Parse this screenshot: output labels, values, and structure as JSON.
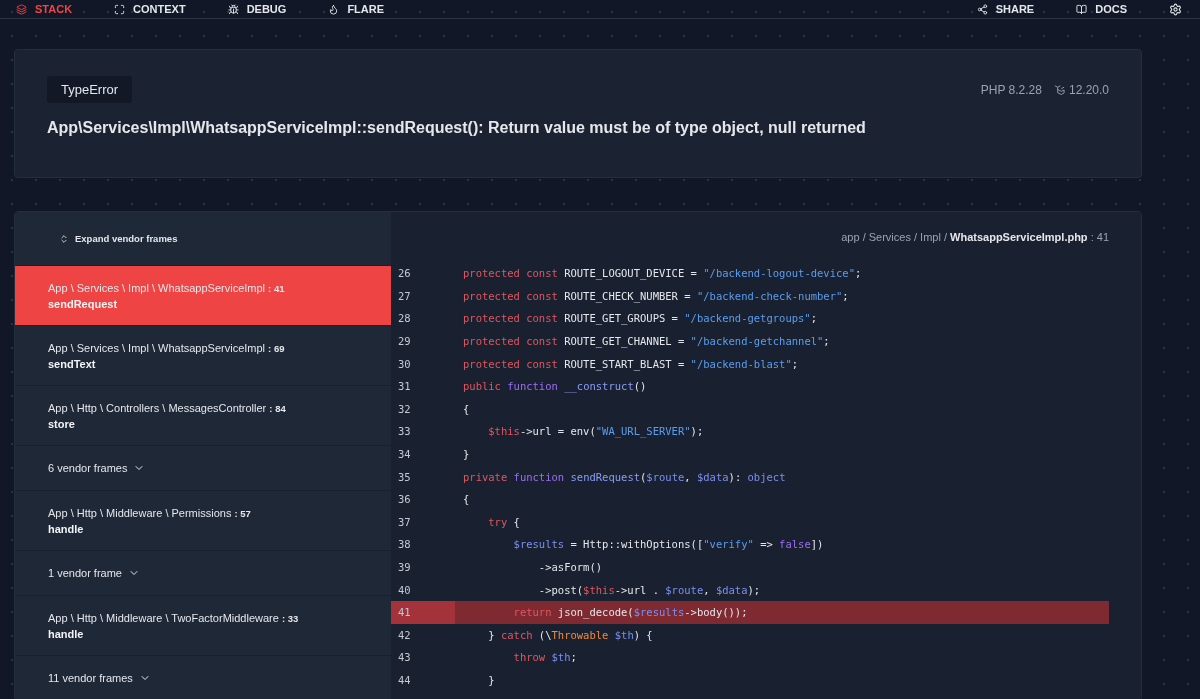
{
  "nav": {
    "left": [
      {
        "label": "STACK",
        "selected": true
      },
      {
        "label": "CONTEXT",
        "selected": false
      },
      {
        "label": "DEBUG",
        "selected": false
      },
      {
        "label": "FLARE",
        "selected": false
      }
    ],
    "right": [
      {
        "label": "SHARE"
      },
      {
        "label": "DOCS"
      }
    ]
  },
  "error": {
    "type": "TypeError",
    "php_version": "PHP 8.2.28",
    "laravel_version": "12.20.0",
    "message": "App\\Services\\Impl\\WhatsappServiceImpl::sendRequest(): Return value must be of type object, null returned"
  },
  "frames_panel": {
    "expand_label": "Expand vendor frames",
    "frames": [
      {
        "kind": "frame",
        "path": "App \\ Services \\ Impl \\ WhatsappServiceImpl",
        "line": ": 41",
        "method": "sendRequest",
        "selected": true
      },
      {
        "kind": "frame",
        "path": "App \\ Services \\ Impl \\ WhatsappServiceImpl",
        "line": ": 69",
        "method": "sendText",
        "selected": false
      },
      {
        "kind": "frame",
        "path": "App \\ Http \\ Controllers \\ MessagesController",
        "line": ": 84",
        "method": "store",
        "selected": false
      },
      {
        "kind": "vendor",
        "label": "6 vendor frames",
        "selected": false
      },
      {
        "kind": "frame",
        "path": "App \\ Http \\ Middleware \\ Permissions",
        "line": ": 57",
        "method": "handle",
        "selected": false
      },
      {
        "kind": "vendor",
        "label": "1 vendor frame",
        "selected": false
      },
      {
        "kind": "frame",
        "path": "App \\ Http \\ Middleware \\ TwoFactorMiddleware",
        "line": ": 33",
        "method": "handle",
        "selected": false
      },
      {
        "kind": "vendor",
        "label": "11 vendor frames",
        "selected": false
      }
    ]
  },
  "code": {
    "file_path": "app / Services / Impl / **WhatsappServiceImpl.php** : 41",
    "lines": [
      {
        "number": "26",
        "selected": false,
        "tokens": [
          {
            "kind": "kw",
            "text": "protected const "
          },
          {
            "kind": "plain",
            "text": "ROUTE_LOGOUT_DEVICE = "
          },
          {
            "kind": "str",
            "text": "\"/backend-logout-device\""
          },
          {
            "kind": "plain",
            "text": ";"
          }
        ]
      },
      {
        "number": "27",
        "selected": false,
        "tokens": [
          {
            "kind": "kw",
            "text": "protected const "
          },
          {
            "kind": "plain",
            "text": "ROUTE_CHECK_NUMBER = "
          },
          {
            "kind": "str",
            "text": "\"/backend-check-number\""
          },
          {
            "kind": "plain",
            "text": ";"
          }
        ]
      },
      {
        "number": "28",
        "selected": false,
        "tokens": [
          {
            "kind": "kw",
            "text": "protected const "
          },
          {
            "kind": "plain",
            "text": "ROUTE_GET_GROUPS = "
          },
          {
            "kind": "str",
            "text": "\"/backend-getgroups\""
          },
          {
            "kind": "plain",
            "text": ";"
          }
        ]
      },
      {
        "number": "29",
        "selected": false,
        "tokens": [
          {
            "kind": "kw",
            "text": "protected const "
          },
          {
            "kind": "plain",
            "text": "ROUTE_GET_CHANNEL = "
          },
          {
            "kind": "str",
            "text": "\"/backend-getchannel\""
          },
          {
            "kind": "plain",
            "text": ";"
          }
        ]
      },
      {
        "number": "30",
        "selected": false,
        "tokens": [
          {
            "kind": "kw",
            "text": "protected const "
          },
          {
            "kind": "plain",
            "text": "ROUTE_START_BLAST = "
          },
          {
            "kind": "str",
            "text": "\"/backend-blast\""
          },
          {
            "kind": "plain",
            "text": ";"
          }
        ]
      },
      {
        "number": "31",
        "selected": false,
        "tokens": [
          {
            "kind": "kw",
            "text": "public "
          },
          {
            "kind": "fn",
            "text": "function "
          },
          {
            "kind": "name",
            "text": "__construct"
          },
          {
            "kind": "plain",
            "text": "()"
          }
        ]
      },
      {
        "number": "32",
        "selected": false,
        "tokens": [
          {
            "kind": "plain",
            "text": "{"
          }
        ]
      },
      {
        "number": "33",
        "selected": false,
        "tokens": [
          {
            "kind": "kw",
            "text": "    $this"
          },
          {
            "kind": "plain",
            "text": "->url = env("
          },
          {
            "kind": "str",
            "text": "\"WA_URL_SERVER\""
          },
          {
            "kind": "plain",
            "text": ");"
          }
        ]
      },
      {
        "number": "34",
        "selected": false,
        "tokens": [
          {
            "kind": "plain",
            "text": "}"
          }
        ]
      },
      {
        "number": "35",
        "selected": false,
        "tokens": [
          {
            "kind": "kw",
            "text": "private "
          },
          {
            "kind": "fn",
            "text": "function "
          },
          {
            "kind": "name",
            "text": "sendRequest"
          },
          {
            "kind": "plain",
            "text": "("
          },
          {
            "kind": "var",
            "text": "$route"
          },
          {
            "kind": "plain",
            "text": ", "
          },
          {
            "kind": "var",
            "text": "$data"
          },
          {
            "kind": "plain",
            "text": "): "
          },
          {
            "kind": "var",
            "text": "object"
          }
        ]
      },
      {
        "number": "36",
        "selected": false,
        "tokens": [
          {
            "kind": "plain",
            "text": "{"
          }
        ]
      },
      {
        "number": "37",
        "selected": false,
        "tokens": [
          {
            "kind": "kw",
            "text": "    try"
          },
          {
            "kind": "plain",
            "text": " {"
          }
        ]
      },
      {
        "number": "38",
        "selected": false,
        "tokens": [
          {
            "kind": "var",
            "text": "        $results"
          },
          {
            "kind": "plain",
            "text": " = Http::withOptions(["
          },
          {
            "kind": "str",
            "text": "\"verify\""
          },
          {
            "kind": "plain",
            "text": " => "
          },
          {
            "kind": "fn",
            "text": "false"
          },
          {
            "kind": "plain",
            "text": "])"
          }
        ]
      },
      {
        "number": "39",
        "selected": false,
        "tokens": [
          {
            "kind": "plain",
            "text": "            ->asForm()"
          }
        ]
      },
      {
        "number": "40",
        "selected": false,
        "tokens": [
          {
            "kind": "plain",
            "text": "            ->post("
          },
          {
            "kind": "kw",
            "text": "$this"
          },
          {
            "kind": "plain",
            "text": "->url . "
          },
          {
            "kind": "var",
            "text": "$route"
          },
          {
            "kind": "plain",
            "text": ", "
          },
          {
            "kind": "var",
            "text": "$data"
          },
          {
            "kind": "plain",
            "text": ");"
          }
        ]
      },
      {
        "number": "41",
        "selected": true,
        "tokens": [
          {
            "kind": "kw",
            "text": "        return"
          },
          {
            "kind": "plain",
            "text": " json_decode("
          },
          {
            "kind": "var",
            "text": "$results"
          },
          {
            "kind": "plain",
            "text": "->body());"
          }
        ]
      },
      {
        "number": "42",
        "selected": false,
        "tokens": [
          {
            "kind": "plain",
            "text": "    } "
          },
          {
            "kind": "kw",
            "text": "catch"
          },
          {
            "kind": "plain",
            "text": " (\\"
          },
          {
            "kind": "cls",
            "text": "Throwable"
          },
          {
            "kind": "var",
            "text": " $th"
          },
          {
            "kind": "plain",
            "text": ") {"
          }
        ]
      },
      {
        "number": "43",
        "selected": false,
        "tokens": [
          {
            "kind": "kw",
            "text": "        throw"
          },
          {
            "kind": "var",
            "text": " $th"
          },
          {
            "kind": "plain",
            "text": ";"
          }
        ]
      },
      {
        "number": "44",
        "selected": false,
        "tokens": [
          {
            "kind": "plain",
            "text": "    }"
          }
        ]
      }
    ]
  }
}
